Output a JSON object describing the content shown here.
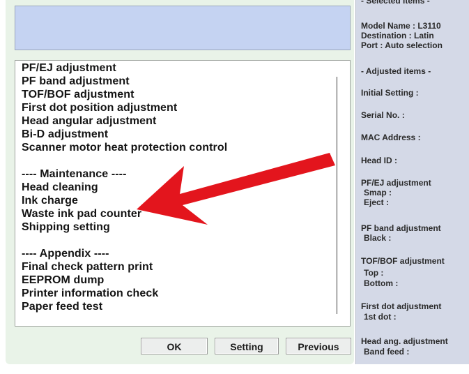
{
  "list": {
    "items": [
      "PF/EJ adjustment",
      "PF band adjustment",
      "TOF/BOF adjustment",
      "First dot position adjustment",
      "Head angular adjustment",
      "Bi-D adjustment",
      "Scanner motor heat protection control",
      "",
      "---- Maintenance ----",
      "Head cleaning",
      "Ink charge",
      "Waste ink pad counter",
      "Shipping setting",
      "",
      "---- Appendix ----",
      "Final check pattern print",
      "EEPROM dump",
      "Printer information check",
      "Paper feed test"
    ]
  },
  "buttons": {
    "ok": "OK",
    "setting": "Setting",
    "previous": "Previous"
  },
  "info": {
    "selected_header": "- Selected items -",
    "model_name": "Model Name : L3110",
    "destination": "Destination : Latin",
    "port": "Port : Auto selection",
    "adjusted_header": "- Adjusted items -",
    "initial_setting": "Initial Setting :",
    "serial_no": "Serial No. :",
    "mac_address": "MAC Address :",
    "head_id": "Head ID :",
    "pfej": "PF/EJ adjustment",
    "smap": "Smap :",
    "eject": "Eject :",
    "pf_band": "PF band adjustment",
    "black": "Black :",
    "tofbof": "TOF/BOF adjustment",
    "top": "Top :",
    "bottom": "Bottom :",
    "first_dot": "First dot adjustment",
    "first_dot_value": "1st dot :",
    "head_ang": "Head ang. adjustment",
    "band_feed": "Band feed :"
  },
  "colors": {
    "arrow": "#e3151d",
    "dialog_bg": "#e9f3e8",
    "top_box": "#c5d3f2",
    "info_panel": "#d4d9e7"
  },
  "annotation": {
    "icon": "red-arrow-icon"
  }
}
